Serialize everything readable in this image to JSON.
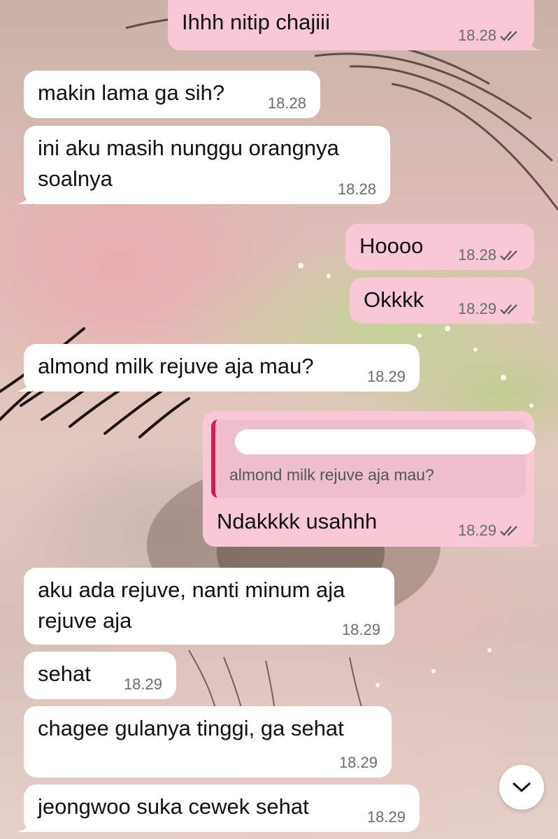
{
  "chat": {
    "messages": [
      {
        "id": "m1",
        "direction": "out",
        "text": "Ihhh nitip chajiii",
        "time": "18.28",
        "status_icon": "double-check-icon"
      },
      {
        "id": "m2",
        "direction": "in",
        "text": "makin lama ga sih?",
        "time": "18.28"
      },
      {
        "id": "m3",
        "direction": "in",
        "text": "ini aku masih nunggu orangnya\nsoalnya",
        "time": "18.28"
      },
      {
        "id": "m4",
        "direction": "out",
        "text": "Hoooo",
        "time": "18.28",
        "status_icon": "double-check-icon"
      },
      {
        "id": "m5",
        "direction": "out",
        "text": "Okkkk",
        "time": "18.29",
        "status_icon": "double-check-icon"
      },
      {
        "id": "m6",
        "direction": "in",
        "text": "almond milk rejuve aja mau?",
        "time": "18.29"
      },
      {
        "id": "m7",
        "direction": "out",
        "text": "Ndakkkk usahhh",
        "time": "18.29",
        "status_icon": "double-check-icon",
        "reply_to": {
          "author": "",
          "text": "almond milk rejuve aja mau?"
        }
      },
      {
        "id": "m8",
        "direction": "in",
        "text": "aku ada rejuve, nanti minum aja\nrejuve aja",
        "time": "18.29"
      },
      {
        "id": "m9",
        "direction": "in",
        "text": "sehat",
        "time": "18.29"
      },
      {
        "id": "m10",
        "direction": "in",
        "text": "chagee gulanya tinggi, ga sehat",
        "time": "18.29"
      },
      {
        "id": "m11",
        "direction": "in",
        "text": "jeongwoo suka cewek sehat",
        "time": "18.29"
      }
    ]
  },
  "controls": {
    "scroll_down_icon": "chevron-down-icon"
  },
  "colors": {
    "incoming_bubble": "#ffffff",
    "outgoing_bubble": "#f8c8d4",
    "reply_accent": "#d81b4a",
    "timestamp": "#6b6b6b"
  }
}
